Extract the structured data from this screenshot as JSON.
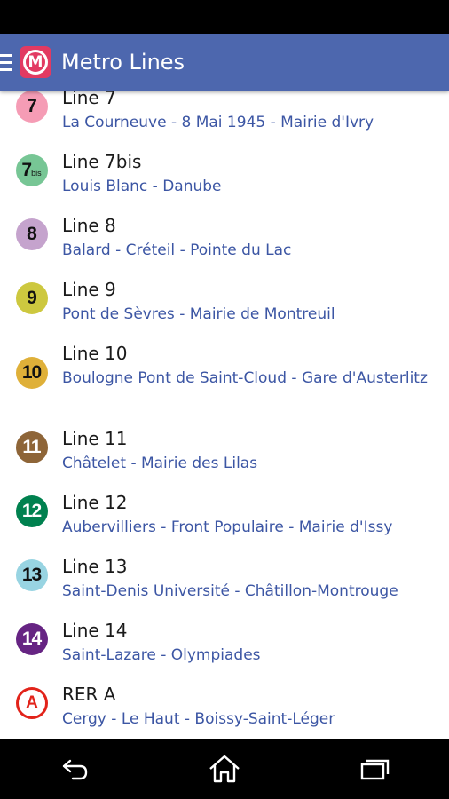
{
  "app": {
    "title": "Metro Lines",
    "logo_letter": "M",
    "bar_color": "#4d67ae"
  },
  "lines": [
    {
      "badge": "7",
      "name": "Line 7",
      "route": "La Courneuve - 8 Mai 1945 - Mairie d'Ivry",
      "color": "#f59cb5",
      "text_white": false
    },
    {
      "badge": "7",
      "badge_sub": "bis",
      "name": "Line 7bis",
      "route": "Louis Blanc - Danube",
      "color": "#77c695",
      "text_white": false
    },
    {
      "badge": "8",
      "name": "Line 8",
      "route": "Balard - Créteil - Pointe du Lac",
      "color": "#c5a3cd",
      "text_white": false
    },
    {
      "badge": "9",
      "name": "Line 9",
      "route": "Pont de Sèvres - Mairie de Montreuil",
      "color": "#cdc83f",
      "text_white": false
    },
    {
      "badge": "10",
      "name": "Line 10",
      "route": "Boulogne Pont de Saint-Cloud - Gare d'Austerlitz",
      "color": "#dfb039",
      "text_white": false
    },
    {
      "badge": "11",
      "name": "Line 11",
      "route": "Châtelet - Mairie des Lilas",
      "color": "#8e6538",
      "text_white": true
    },
    {
      "badge": "12",
      "name": "Line 12",
      "route": "Aubervilliers - Front Populaire - Mairie d'Issy",
      "color": "#00814f",
      "text_white": true
    },
    {
      "badge": "13",
      "name": "Line 13",
      "route": "Saint-Denis Université - Châtillon-Montrouge",
      "color": "#98d4e2",
      "text_white": false
    },
    {
      "badge": "14",
      "name": "Line 14",
      "route": "Saint-Lazare - Olympiades",
      "color": "#662483",
      "text_white": true
    },
    {
      "badge": "A",
      "name": "RER A",
      "route": "Cergy - Le Haut - Boissy-Saint-Léger",
      "color": "#e2231a",
      "rer": true
    }
  ],
  "nav": {
    "back_icon": "back-icon",
    "home_icon": "home-icon",
    "recents_icon": "recents-icon"
  }
}
